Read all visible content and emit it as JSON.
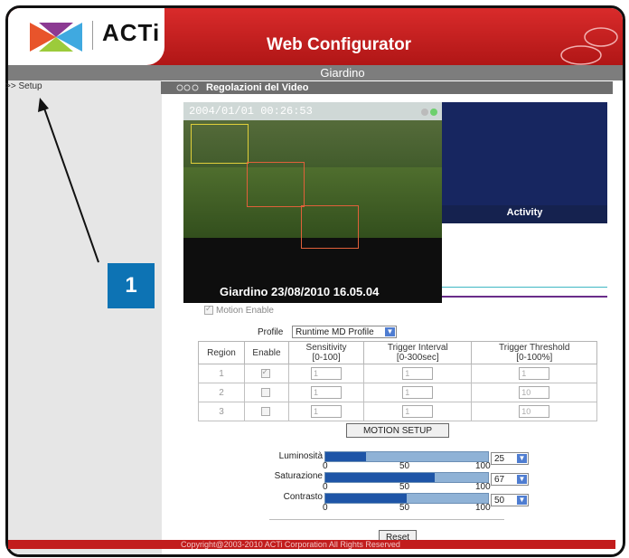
{
  "brand": {
    "logo_text": "ACTi",
    "app_title": "Web Configurator",
    "site_name": "Giardino"
  },
  "sidebar": {
    "setup_link": ">> Setup"
  },
  "section": {
    "title": "Regolazioni del Video"
  },
  "video": {
    "timestamp": "2004/01/01 00:26:53",
    "caption": "Giardino 23/08/2010 16.05.04",
    "activity_label": "Activity"
  },
  "motion": {
    "enable_label": "Motion Enable",
    "enabled": true,
    "profile_label": "Profile",
    "profile_value": "Runtime MD Profile",
    "table": {
      "headers": [
        "Region",
        "Enable",
        "Sensitivity [0-100]",
        "Trigger Interval [0-300sec]",
        "Trigger Threshold [0-100%]"
      ],
      "header_lines": [
        [
          "Region",
          ""
        ],
        [
          "Enable",
          ""
        ],
        [
          "Sensitivity",
          "[0-100]"
        ],
        [
          "Trigger Interval",
          "[0-300sec]"
        ],
        [
          "Trigger Threshold",
          "[0-100%]"
        ]
      ],
      "rows": [
        {
          "region": "1",
          "enabled": true,
          "sensitivity": "1",
          "interval": "1",
          "threshold": "1"
        },
        {
          "region": "2",
          "enabled": false,
          "sensitivity": "1",
          "interval": "1",
          "threshold": "10"
        },
        {
          "region": "3",
          "enabled": false,
          "sensitivity": "1",
          "interval": "1",
          "threshold": "10"
        }
      ]
    },
    "setup_button": "MOTION SETUP"
  },
  "adjustments": {
    "scale": {
      "min": "0",
      "mid": "50",
      "max": "100"
    },
    "brightness": {
      "label": "Luminosità",
      "value": "25",
      "level_percent": 25
    },
    "saturation": {
      "label": "Saturazione",
      "value": "67",
      "level_percent": 67
    },
    "contrast": {
      "label": "Contrasto",
      "value": "50",
      "level_percent": 50
    }
  },
  "reset_button": "Reset",
  "footer": {
    "copyright": "Copyright@2003-2010 ACTi Corporation All Rights Reserved"
  },
  "callout": {
    "number": "1"
  },
  "colors": {
    "header_red": "#c21d1d",
    "accent_blue": "#0d73b4",
    "slider_fill": "#1e55a7"
  }
}
